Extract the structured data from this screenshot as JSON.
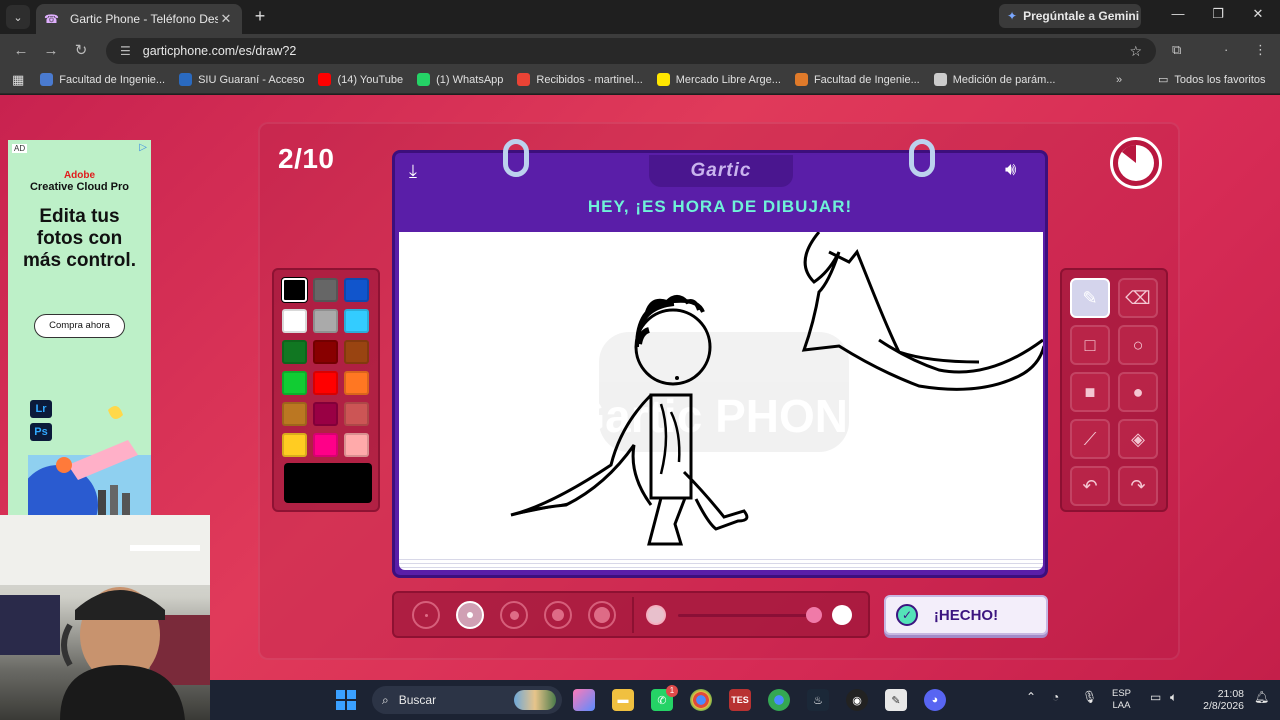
{
  "browser": {
    "tab_title": "Gartic Phone - Teléfono Descon",
    "gemini_label": "Pregúntale a Gemini",
    "url": "garticphone.com/es/draw?2",
    "bookmarks": [
      {
        "label": "Facultad de Ingenie...",
        "color": "#4a7bd0"
      },
      {
        "label": "SIU Guaraní - Acceso",
        "color": "#2a6ac0"
      },
      {
        "label": "(14) YouTube",
        "color": "#ff0000"
      },
      {
        "label": "(1) WhatsApp",
        "color": "#25d366"
      },
      {
        "label": "Recibidos - martinel...",
        "color": "#ea4335"
      },
      {
        "label": "Mercado Libre Arge...",
        "color": "#ffe600"
      },
      {
        "label": "Facultad de Ingenie...",
        "color": "#e07a2a"
      },
      {
        "label": "Medición de parám...",
        "color": "#cccccc"
      }
    ],
    "all_bookmarks_label": "Todos los favoritos"
  },
  "ad": {
    "tag": "AD",
    "brand": "Adobe",
    "product": "Creative Cloud Pro",
    "headline": "Edita tus fotos con más control.",
    "cta": "Compra ahora",
    "app1": "Lr",
    "app2": "Ps"
  },
  "game": {
    "round": "2/10",
    "logo": "Gartic",
    "headline": "HEY, ¡ES HORA DE DIBUJAR!",
    "watermark": "Gartic PHONE",
    "done_label": "¡HECHO!",
    "palette": [
      [
        "#000000",
        "#666666",
        "#1155cc"
      ],
      [
        "#ffffff",
        "#aaaaaa",
        "#33ccff"
      ],
      [
        "#117722",
        "#880000",
        "#994411"
      ],
      [
        "#11cc33",
        "#ff0000",
        "#ff7722"
      ],
      [
        "#bb7722",
        "#990044",
        "#cc5555"
      ],
      [
        "#ffcc22",
        "#ff0088",
        "#ffaaaa"
      ]
    ],
    "current_color": "#000000",
    "brush_sizes_selected_index": 1,
    "opacity_level": 1.0
  },
  "taskbar": {
    "search_label": "Buscar",
    "lang_line1": "ESP",
    "lang_line2": "LAA",
    "time": "21:08",
    "date": "2/8/2026",
    "whatsapp_badge": "1"
  }
}
